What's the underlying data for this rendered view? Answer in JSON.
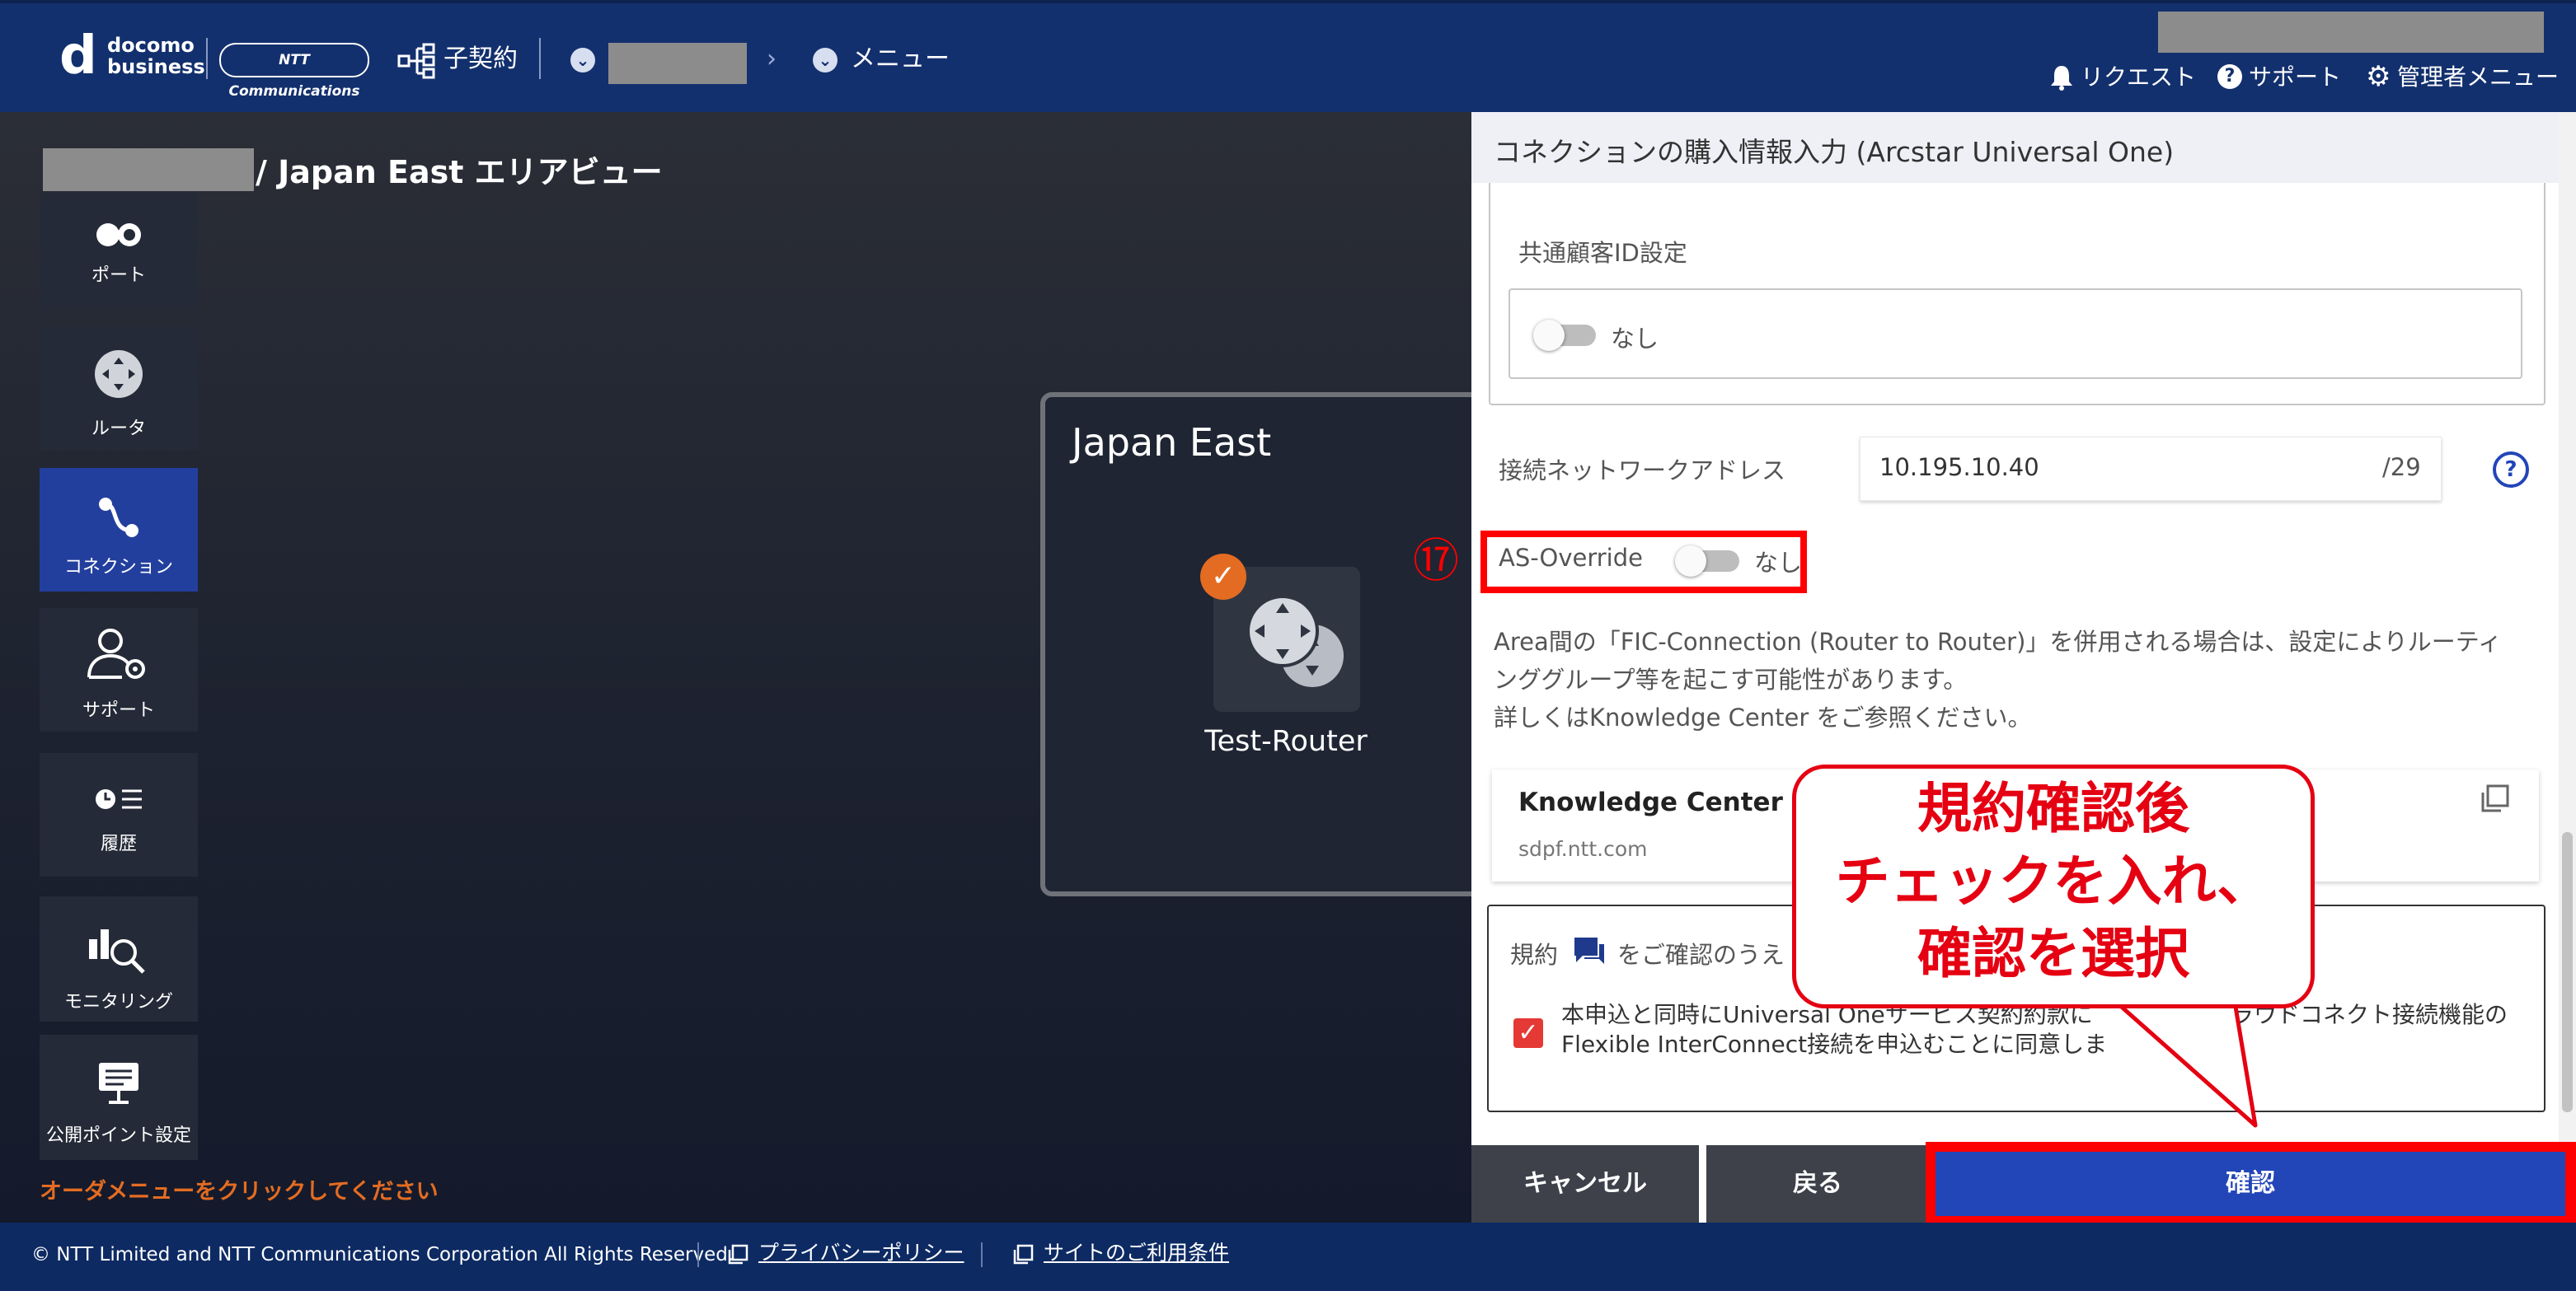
{
  "header": {
    "logo_mark": "d",
    "logo_line1": "docomo",
    "logo_line2": "business",
    "partner_logo": "NTT Communications",
    "child_contract": "子契約",
    "menu": "メニュー",
    "request": "リクエスト",
    "support": "サポート",
    "admin_menu": "管理者メニュー"
  },
  "area_title": "/ Japan East エリアビュー",
  "sidebar": {
    "items": [
      {
        "label": "ポート",
        "icon": "port-icon"
      },
      {
        "label": "ルータ",
        "icon": "router-icon"
      },
      {
        "label": "コネクション",
        "icon": "connection-icon",
        "active": true
      },
      {
        "label": "サポート",
        "icon": "support-user-icon"
      },
      {
        "label": "履歴",
        "icon": "history-icon"
      },
      {
        "label": "モニタリング",
        "icon": "monitoring-icon"
      },
      {
        "label": "公開ポイント設定",
        "icon": "public-point-icon"
      }
    ],
    "order_message": "オーダメニューをクリックしてください"
  },
  "canvas": {
    "region_name": "Japan East",
    "router_name": "Test-Router"
  },
  "panel": {
    "title": "コネクションの購入情報入力 (Arcstar Universal One)",
    "common_customer_id_label": "共通顧客ID設定",
    "common_customer_id_toggle": "なし",
    "network_address_label": "接続ネットワークアドレス",
    "network_address_value": "10.195.10.40",
    "network_address_suffix": "/29",
    "help_icon": "?",
    "step_marker": "⑰",
    "as_override_label": "AS-Override",
    "as_override_toggle": "なし",
    "note_line1": "Area間の「FIC-Connection (Router to Router)」を併用される場合は、設定によりルーティ",
    "note_line2": "ンググループ等を起こす可能性があります。",
    "note_line3": "詳しくはKnowledge Center をご参照ください。",
    "knowledge_title": "Knowledge Center",
    "knowledge_url": "sdpf.ntt.com",
    "terms_prefix": "規約",
    "terms_suffix": "をご確認のうえ",
    "agree_line1": "本申込と同時にUniversal Oneサービス契約約款に",
    "agree_line1b": "ラウドコネクト接続機能の",
    "agree_line2": "Flexible InterConnect接続を申込むことに同意しま",
    "checkbox_checked": true
  },
  "buttons": {
    "cancel": "キャンセル",
    "back": "戻る",
    "confirm": "確認"
  },
  "callout": {
    "line1": "規約確認後",
    "line2": "チェックを入れ、",
    "line3": "確認を選択"
  },
  "footer": {
    "copyright": "© NTT Limited and NTT Communications Corporation All Rights Reserved.",
    "privacy": "プライバシーポリシー",
    "terms": "サイトのご利用条件"
  },
  "colors": {
    "header_bg": "#13306e",
    "accent_blue": "#2245b8",
    "highlight_red": "#ff0000",
    "orange": "#e36c22"
  }
}
